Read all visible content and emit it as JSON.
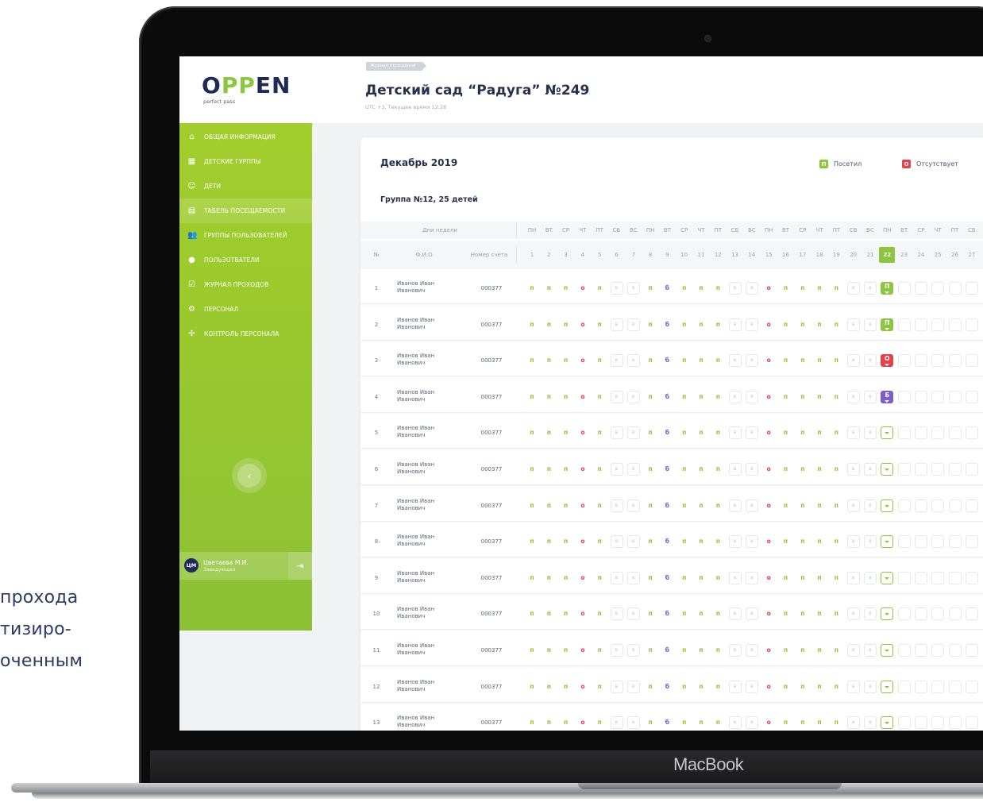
{
  "side_text": [
    "проходa",
    "тизиро-",
    "оченным"
  ],
  "device_brand": "MacBook",
  "app": {
    "logo_text_1": "O",
    "logo_text_2": "PP",
    "logo_text_3": "EN",
    "logo_sub": "perfect pass"
  },
  "sidebar": {
    "items": [
      {
        "label": "ОБЩАЯ ИНФОРМАЦИЯ",
        "icon": "home-icon",
        "glyph": "⌂"
      },
      {
        "label": "ДЕТСКИЕ ГУРППЫ",
        "icon": "grid-icon",
        "glyph": "▦"
      },
      {
        "label": "ДЕТИ",
        "icon": "smile-icon",
        "glyph": "☺"
      },
      {
        "label": "ТАБЕЛЬ ПОСЕЩАЕМОСТИ",
        "icon": "document-icon",
        "glyph": "▤",
        "active": true
      },
      {
        "label": "ГРУППЫ ПОЛЬЗОВАТЕЛЕЙ",
        "icon": "users-icon",
        "glyph": "👥"
      },
      {
        "label": "ПОЛЬЗОТВАТЕЛИ",
        "icon": "user-icon",
        "glyph": "●"
      },
      {
        "label": "ЖУРНАЛ ПРОХОДОВ",
        "icon": "checkbox-icon",
        "glyph": "☑"
      },
      {
        "label": "ПЕРСОНАЛ",
        "icon": "gear-icon",
        "glyph": "⚙"
      },
      {
        "label": "КОНТРОЛЬ ПЕРСОНАЛА",
        "icon": "network-icon",
        "glyph": "✣"
      }
    ],
    "collapse_glyph": "‹",
    "user": {
      "initials": "ЦМ",
      "name": "Цветаева М.И.",
      "role": "Заведующая"
    },
    "logout_glyph": "⇥"
  },
  "header": {
    "breadcrumb": "Журнал посещений",
    "title": "Детский сад “Радуга” №249",
    "subtitle": "UTC +3, Текущее время 12:28"
  },
  "card": {
    "month": "Декабрь 2019",
    "group": "Группа №12, 25 детей",
    "legend": [
      {
        "code": "П",
        "label": "Посетил",
        "color": "#8cc63f"
      },
      {
        "code": "О",
        "label": "Отсутствует",
        "color": "#e5414a"
      }
    ],
    "col_weekdays": "Дни недели",
    "col_num": "№",
    "col_name": "Ф.И.О",
    "col_account": "Номер счета",
    "weekdays": [
      "ПН",
      "ВТ",
      "СР",
      "ЧТ",
      "ПТ",
      "СБ",
      "ВС",
      "ПН",
      "ВТ",
      "СР",
      "ЧТ",
      "ПТ",
      "СБ",
      "ВС",
      "ПН",
      "ВТ",
      "СР",
      "ЧТ",
      "ПТ",
      "СБ",
      "ВС",
      "ПН",
      "ВТ",
      "СР",
      "ЧТ",
      "ПТ",
      "СБ"
    ],
    "days": [
      "1",
      "2",
      "3",
      "4",
      "5",
      "6",
      "7",
      "8",
      "9",
      "10",
      "11",
      "12",
      "13",
      "14",
      "15",
      "16",
      "17",
      "18",
      "19",
      "20",
      "21",
      "22",
      "23",
      "24",
      "25",
      "26",
      "27"
    ],
    "highlight_day": "22"
  },
  "marks_pattern": [
    "п",
    "п",
    "п",
    "о",
    "п",
    "в",
    "в",
    "п",
    "б",
    "п",
    "п",
    "п",
    "в",
    "в",
    "о",
    "п",
    "п",
    "п",
    "п",
    "в",
    "в"
  ],
  "rows": [
    {
      "num": "1",
      "name1": "Иванов Иван",
      "name2": "Иванович",
      "account": "000377",
      "today": "П",
      "state": "fill-green"
    },
    {
      "num": "2",
      "name1": "Иванов Иван",
      "name2": "Иванович",
      "account": "000377",
      "today": "П",
      "state": "fill-green"
    },
    {
      "num": "3",
      "name1": "Иванов Иван",
      "name2": "Иванович",
      "account": "000377",
      "today": "О",
      "state": "fill-red"
    },
    {
      "num": "4",
      "name1": "Иванов Иван",
      "name2": "Иванович",
      "account": "000377",
      "today": "Б",
      "state": "fill-purple"
    },
    {
      "num": "5",
      "name1": "Иванов Иван",
      "name2": "Иванович",
      "account": "000377",
      "today": "",
      "state": "select"
    },
    {
      "num": "6",
      "name1": "Иванов Иван",
      "name2": "Иванович",
      "account": "000377",
      "today": "",
      "state": "select"
    },
    {
      "num": "7",
      "name1": "Иванов Иван",
      "name2": "Иванович",
      "account": "000377",
      "today": "",
      "state": "select"
    },
    {
      "num": "8",
      "name1": "Иванов Иван",
      "name2": "Иванович",
      "account": "000377",
      "today": "",
      "state": "select"
    },
    {
      "num": "9",
      "name1": "Иванов Иван",
      "name2": "Иванович",
      "account": "000377",
      "today": "",
      "state": "select"
    },
    {
      "num": "10",
      "name1": "Иванов Иван",
      "name2": "Иванович",
      "account": "000377",
      "today": "",
      "state": "select"
    },
    {
      "num": "11",
      "name1": "Иванов Иван",
      "name2": "Иванович",
      "account": "000377",
      "today": "",
      "state": "select"
    },
    {
      "num": "12",
      "name1": "Иванов Иван",
      "name2": "Иванович",
      "account": "000377",
      "today": "",
      "state": "select"
    },
    {
      "num": "13",
      "name1": "Иванов Иван",
      "name2": "Иванович",
      "account": "000377",
      "today": "",
      "state": "select"
    }
  ]
}
